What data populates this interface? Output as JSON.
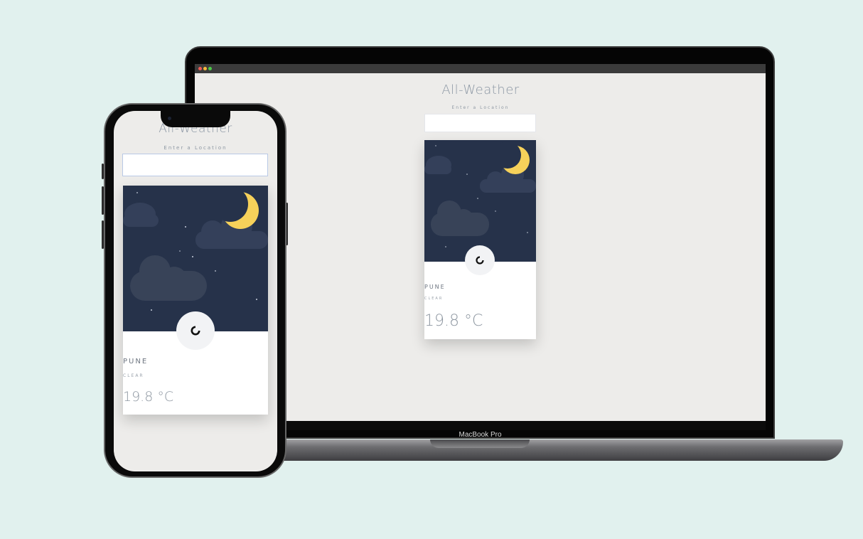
{
  "laptop": {
    "model_label": "MacBook Pro",
    "app": {
      "title": "All-Weather",
      "location_label": "Enter a Location",
      "location_value": "",
      "city": "PUNE",
      "condition": "CLEAR",
      "temperature": "19.8 °C"
    }
  },
  "phone": {
    "app": {
      "title": "All-Weather",
      "location_label": "Enter a Location",
      "location_value": "",
      "city": "PUNE",
      "condition": "CLEAR",
      "temperature": "19.8 °C"
    }
  },
  "icons": {
    "browser_controls": [
      "close-dot",
      "minimize-dot",
      "maximize-dot"
    ],
    "weather": "crescent-moon-icon",
    "status": "loading-spinner-icon",
    "scene": [
      "cloud-icon",
      "star-icon"
    ]
  },
  "colors": {
    "background": "#e1f1ee",
    "sky": "#26324a",
    "moon": "#f6d15a",
    "cloud": "#384358",
    "app_background": "#edecea"
  }
}
